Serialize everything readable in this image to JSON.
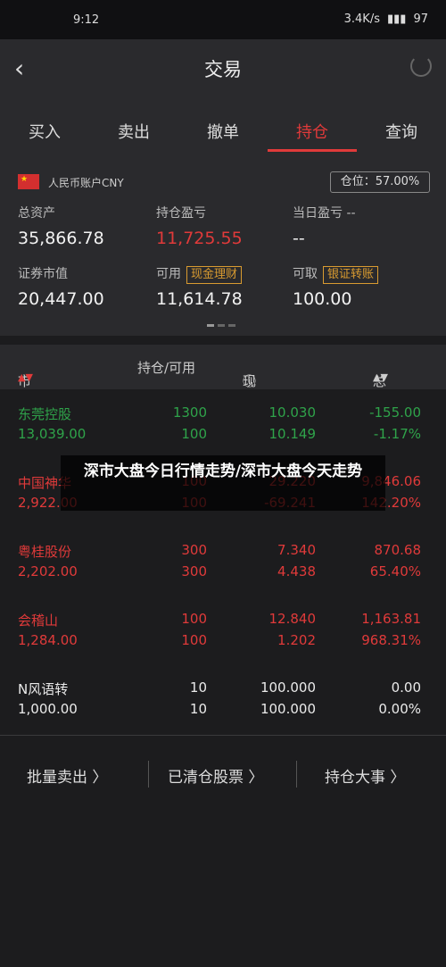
{
  "status": {
    "time": "9:12",
    "speed": "3.4K/s",
    "battery": "97"
  },
  "nav": {
    "title": "交易"
  },
  "tabs": [
    "买入",
    "卖出",
    "撤单",
    "持仓",
    "查询"
  ],
  "summary": {
    "account": "人民币账户CNY",
    "position_ratio": "仓位：57.00%",
    "total_assets_label": "总资产",
    "total_assets": "35,866.78",
    "holding_pl_label": "持仓盈亏",
    "holding_pl": "11,725.55",
    "daily_pl_label": "当日盈亏 --",
    "daily_pl": "--",
    "market_value_label": "证券市值",
    "market_value": "20,447.00",
    "available_label": "可用",
    "available_tag": "现金理财",
    "available": "11,614.78",
    "withdrawable_label": "可取",
    "withdrawable_tag": "银证转账",
    "withdrawable": "100.00"
  },
  "table": {
    "headers": [
      "市值",
      "持仓/可用",
      "现价/成本",
      "总盈亏"
    ],
    "rows": [
      {
        "name": "东莞控股",
        "mv": "13,039.00",
        "hold": "1300",
        "avail": "100",
        "price": "10.030",
        "cost": "10.149",
        "pl": "-155.00",
        "pct": "-1.17%",
        "color": "green"
      },
      {
        "name": "中国神华",
        "mv": "2,922.00",
        "hold": "100",
        "avail": "100",
        "price": "29.220",
        "cost": "-69.241",
        "pl": "9,846.06",
        "pct": "142.20%",
        "color": "red"
      },
      {
        "name": "粤桂股份",
        "mv": "2,202.00",
        "hold": "300",
        "avail": "300",
        "price": "7.340",
        "cost": "4.438",
        "pl": "870.68",
        "pct": "65.40%",
        "color": "red"
      },
      {
        "name": "会稽山",
        "mv": "1,284.00",
        "hold": "100",
        "avail": "100",
        "price": "12.840",
        "cost": "1.202",
        "pl": "1,163.81",
        "pct": "968.31%",
        "color": "red"
      },
      {
        "name": "N风语转",
        "mv": "1,000.00",
        "hold": "10",
        "avail": "10",
        "price": "100.000",
        "cost": "100.000",
        "pl": "0.00",
        "pct": "0.00%",
        "color": "white"
      }
    ]
  },
  "bottom": {
    "batch_sell": "批量卖出 〉",
    "cleared": "已清仓股票 〉",
    "events": "持仓大事 〉"
  },
  "overlay": {
    "text": "深市大盘今日行情走势/深市大盘今天走势"
  }
}
